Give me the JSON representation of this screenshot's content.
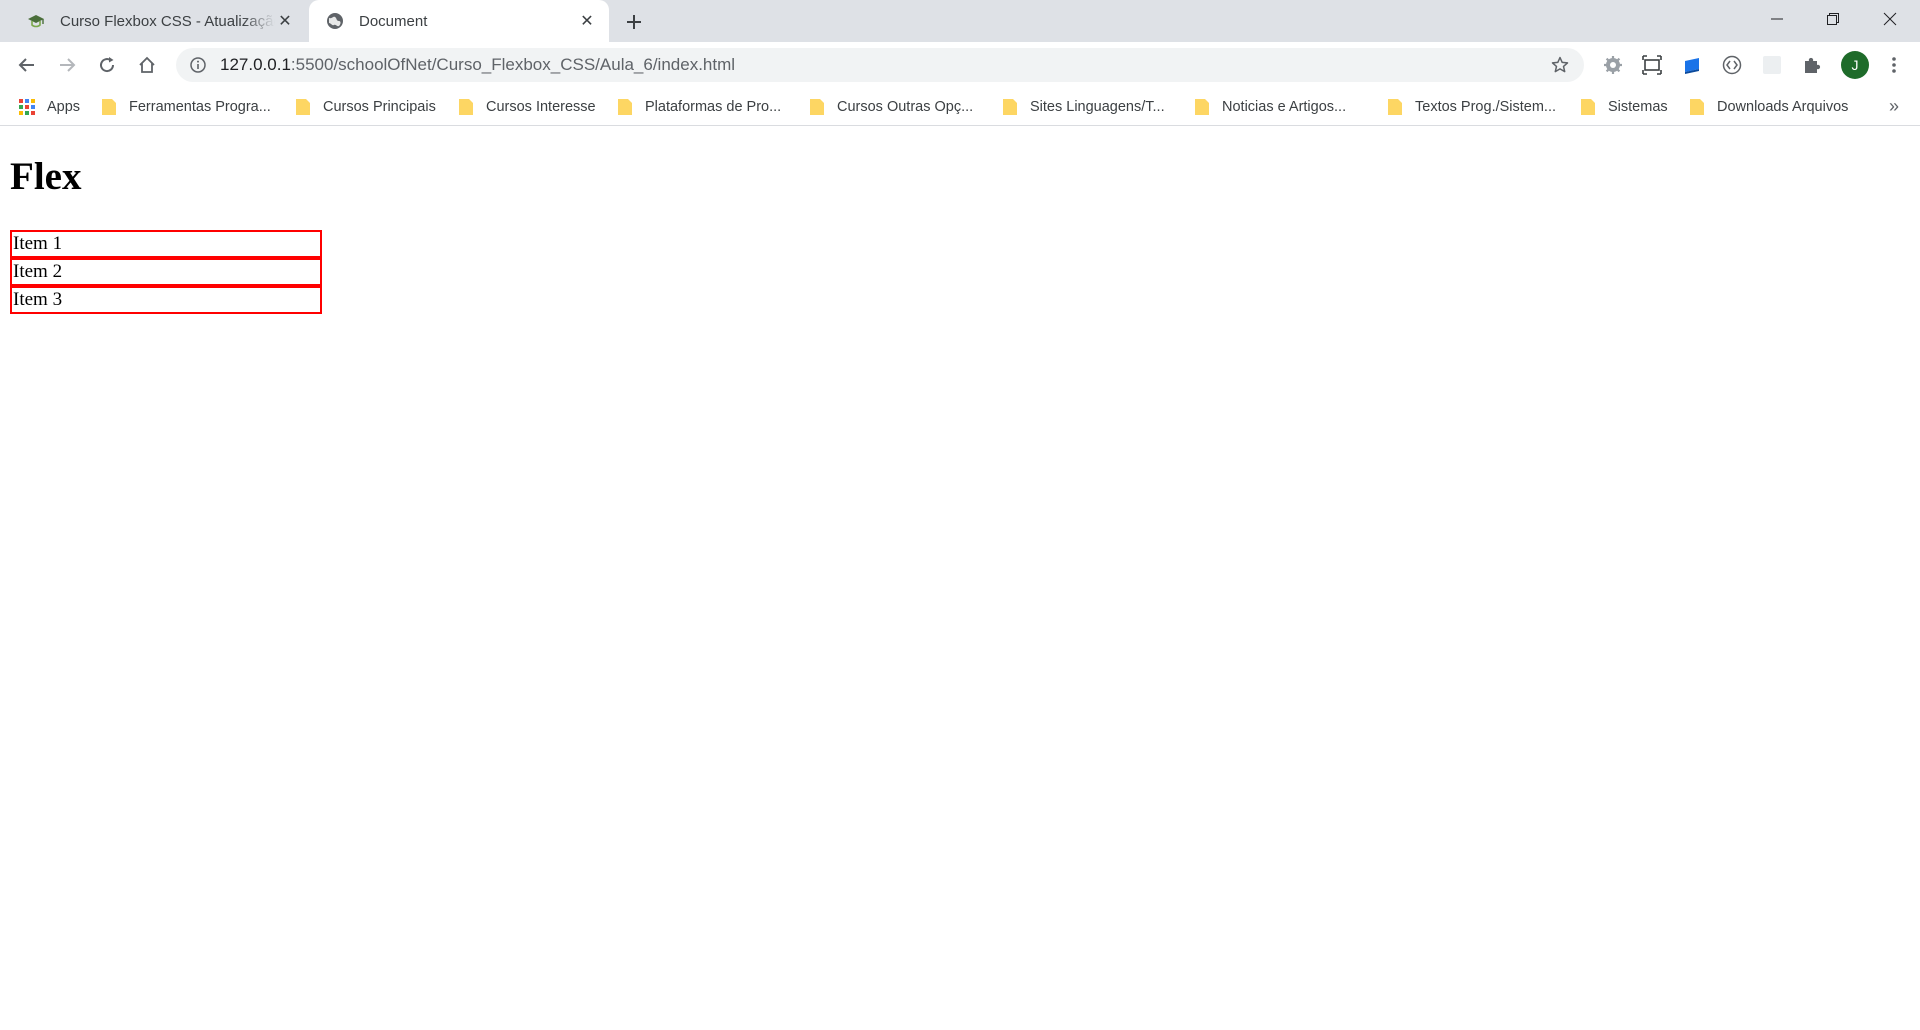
{
  "browser": {
    "tabs": [
      {
        "title": "Curso Flexbox CSS - Atualização",
        "icon": "school-of-net-icon",
        "active": false
      },
      {
        "title": "Document",
        "icon": "globe-icon",
        "active": true
      }
    ],
    "address": {
      "host": "127.0.0.1",
      "path": ":5500/schoolOfNet/Curso_Flexbox_CSS/Aula_6/index.html"
    },
    "profile_initial": "J",
    "extensions": [
      "settings-gear-icon",
      "screen-capture-icon",
      "blue-extension-icon",
      "code-extension-icon",
      "blank-extension-icon",
      "puzzle-icon"
    ],
    "bookmarks": [
      {
        "label": "Apps",
        "icon": "apps-grid-icon"
      },
      {
        "label": "Ferramentas Progra...",
        "icon": "folder-icon"
      },
      {
        "label": "Cursos Principais",
        "icon": "folder-icon"
      },
      {
        "label": "Cursos Interesse",
        "icon": "folder-icon"
      },
      {
        "label": "Plataformas de Pro...",
        "icon": "folder-icon"
      },
      {
        "label": "Cursos Outras Opç...",
        "icon": "folder-icon"
      },
      {
        "label": "Sites Linguagens/T...",
        "icon": "folder-icon"
      },
      {
        "label": "Noticias e Artigos...",
        "icon": "folder-icon"
      },
      {
        "label": "Textos Prog./Sistem...",
        "icon": "folder-icon"
      },
      {
        "label": "Sistemas",
        "icon": "folder-icon"
      },
      {
        "label": "Downloads Arquivos",
        "icon": "folder-icon"
      }
    ],
    "bookmarks_overflow": "»"
  },
  "page": {
    "heading": "Flex",
    "items": [
      "Item 1",
      "Item 2",
      "Item 3"
    ],
    "item_border_color": "#ff0000"
  },
  "colors": {
    "tabstrip_bg": "#dee1e6",
    "omnibox_bg": "#f1f3f4",
    "folder_yellow": "#fdd663",
    "avatar_green": "#1e6b2a"
  }
}
